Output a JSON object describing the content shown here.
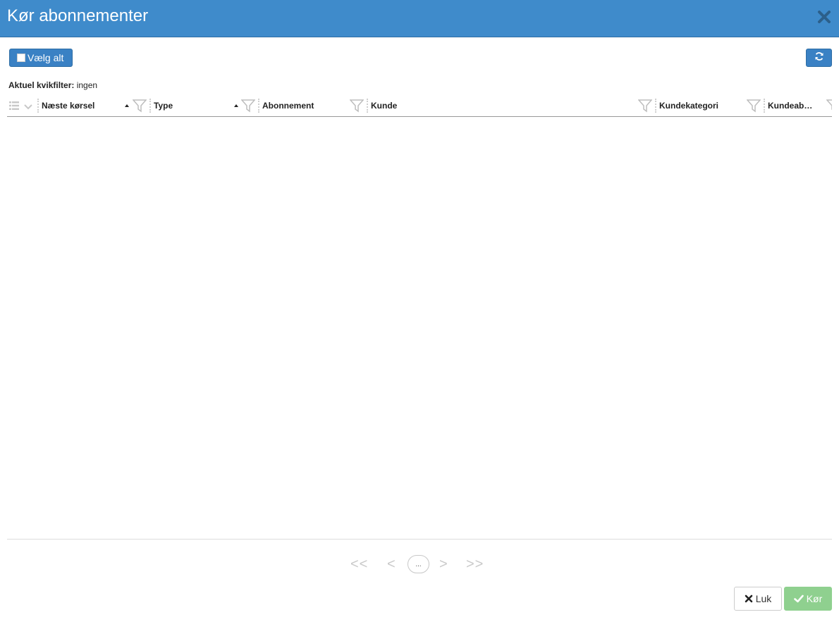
{
  "modal": {
    "title": "Kør abonnementer"
  },
  "toolbar": {
    "select_all_label": "Vælg alt"
  },
  "quickfilter": {
    "label": "Aktuel kvikfilter:",
    "value": "ingen"
  },
  "grid": {
    "columns": [
      {
        "label": "Næste kørsel",
        "sorted": "ascending"
      },
      {
        "label": "Type",
        "sorted": "ascending"
      },
      {
        "label": "Abonnement"
      },
      {
        "label": "Kunde"
      },
      {
        "label": "Kundekategori"
      },
      {
        "label": "Kundeab…"
      }
    ],
    "rows": []
  },
  "pager": {
    "first": "<<",
    "prev": "<",
    "current": "...",
    "next": ">",
    "last": ">>"
  },
  "footer": {
    "close_label": "Luk",
    "run_label": "Kør"
  },
  "colors": {
    "header_bg": "#3f8bcb",
    "primary_button": "#3a81c4",
    "run_button": "#8fd08f"
  }
}
